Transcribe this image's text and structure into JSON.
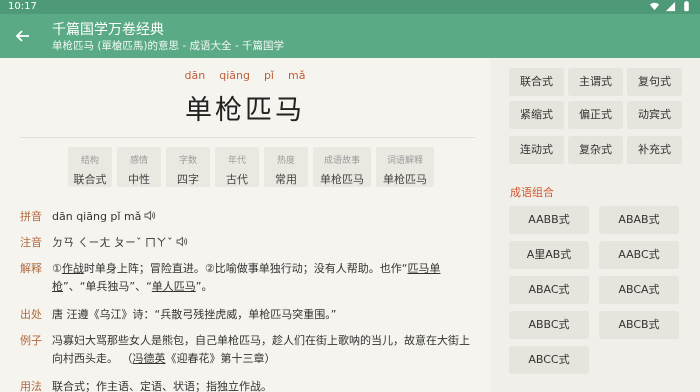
{
  "status": {
    "time": "10:17",
    "icons": [
      "wifi-icon",
      "signal-icon",
      "battery-icon"
    ]
  },
  "appbar": {
    "title": "千篇国学万卷经典",
    "subtitle": "单枪匹马 (單槍匹馬)的意思 - 成语大全 - 千篇国学"
  },
  "word": {
    "pinyin": [
      "dān",
      "qiāng",
      "pǐ",
      "mǎ"
    ],
    "text": "单枪匹马"
  },
  "tags": [
    {
      "k": "结构",
      "v": "联合式"
    },
    {
      "k": "感情",
      "v": "中性"
    },
    {
      "k": "字数",
      "v": "四字"
    },
    {
      "k": "年代",
      "v": "古代"
    },
    {
      "k": "热度",
      "v": "常用"
    },
    {
      "k": "成语故事",
      "v": "单枪匹马"
    },
    {
      "k": "词语解释",
      "v": "单枪匹马"
    }
  ],
  "details": {
    "pinyin": {
      "label": "拼音",
      "value": "dān qiāng pǐ mǎ"
    },
    "zhuyin": {
      "label": "注音",
      "value": "ㄉㄢ ㄑㄧㄤ ㄆㄧˇ ㄇㄚˇ"
    },
    "explain": {
      "label": "解释",
      "p1": "①",
      "l1": "作战",
      "p2": "时单身上阵；冒险直进。②比喻做事单独行动；没有人帮助。也作“",
      "l2": "匹马单枪",
      "p3": "”、“单兵独马”、“",
      "l3": "单人匹马",
      "p4": "”。"
    },
    "source": {
      "label": "出处",
      "value": "唐 汪遵《乌江》诗：“兵散弓残挫虎威，单枪匹马突重围。”"
    },
    "example": {
      "label": "例子",
      "p1": "冯寡妇大骂那些女人是熊包，自己单枪匹马，趁人们在街上歌呐的当儿，故意在大街上向村西头走。 （",
      "l1": "冯德英",
      "p2": "《迎春花》第十三章）"
    },
    "usage": {
      "label": "用法",
      "value": "联合式；作主语、定语、状语；指独立作战。"
    }
  },
  "structure_buttons": [
    "联合式",
    "主谓式",
    "复句式",
    "紧缩式",
    "偏正式",
    "动宾式",
    "连动式",
    "复杂式",
    "补充式"
  ],
  "combo": {
    "title": "成语组合",
    "items": [
      "AABB式",
      "ABAB式",
      "A里AB式",
      "AABC式",
      "ABAC式",
      "ABCA式",
      "ABBC式",
      "ABCB式",
      "ABCC式"
    ]
  },
  "colors": {
    "appbar": "#5aaa85",
    "statusbar": "#4e9a78",
    "accent": "#d1592e"
  }
}
